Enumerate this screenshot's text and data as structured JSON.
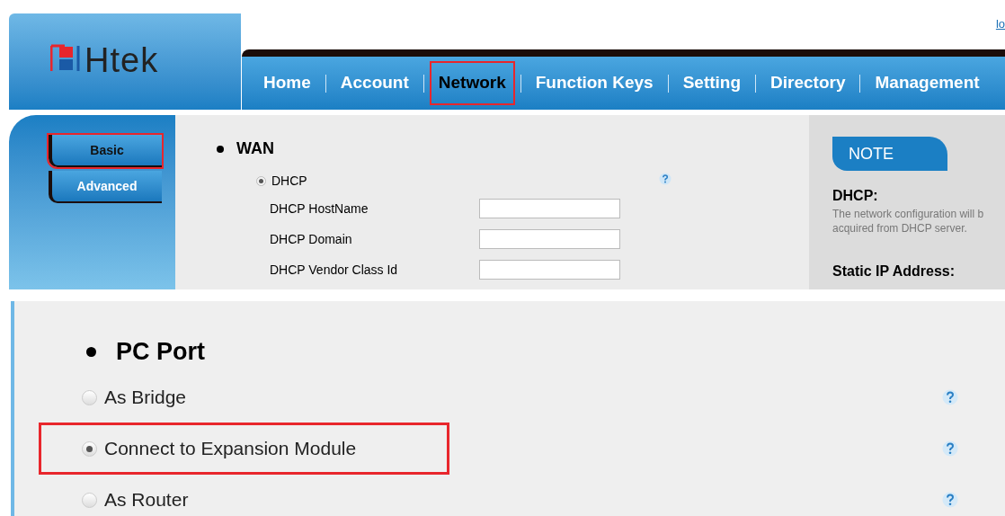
{
  "header": {
    "logo_text": "Htek",
    "top_link": "lo"
  },
  "nav": [
    {
      "label": "Home",
      "selected": false,
      "highlighted": false
    },
    {
      "label": "Account",
      "selected": false,
      "highlighted": false
    },
    {
      "label": "Network",
      "selected": true,
      "highlighted": true
    },
    {
      "label": "Function Keys",
      "selected": false,
      "highlighted": false
    },
    {
      "label": "Setting",
      "selected": false,
      "highlighted": false
    },
    {
      "label": "Directory",
      "selected": false,
      "highlighted": false
    },
    {
      "label": "Management",
      "selected": false,
      "highlighted": false
    }
  ],
  "sidebar": {
    "items": [
      {
        "label": "Basic",
        "selected": true,
        "highlighted": true
      },
      {
        "label": "Advanced",
        "selected": false,
        "highlighted": false
      }
    ]
  },
  "wan": {
    "title": "WAN",
    "option": {
      "label": "DHCP",
      "checked": true
    },
    "fields": [
      {
        "label": "DHCP HostName"
      },
      {
        "label": "DHCP Domain"
      },
      {
        "label": "DHCP Vendor Class Id"
      }
    ]
  },
  "note": {
    "title": "NOTE",
    "heading": "DHCP:",
    "lines": [
      "The network configuration will b",
      "acquired from DHCP server."
    ],
    "next_heading": "Static IP Address:"
  },
  "pc_port": {
    "title": "PC Port",
    "options": [
      {
        "label": "As Bridge",
        "checked": false,
        "highlighted": false
      },
      {
        "label": "Connect to Expansion Module",
        "checked": true,
        "highlighted": true
      },
      {
        "label": "As Router",
        "checked": false,
        "highlighted": false
      }
    ]
  }
}
